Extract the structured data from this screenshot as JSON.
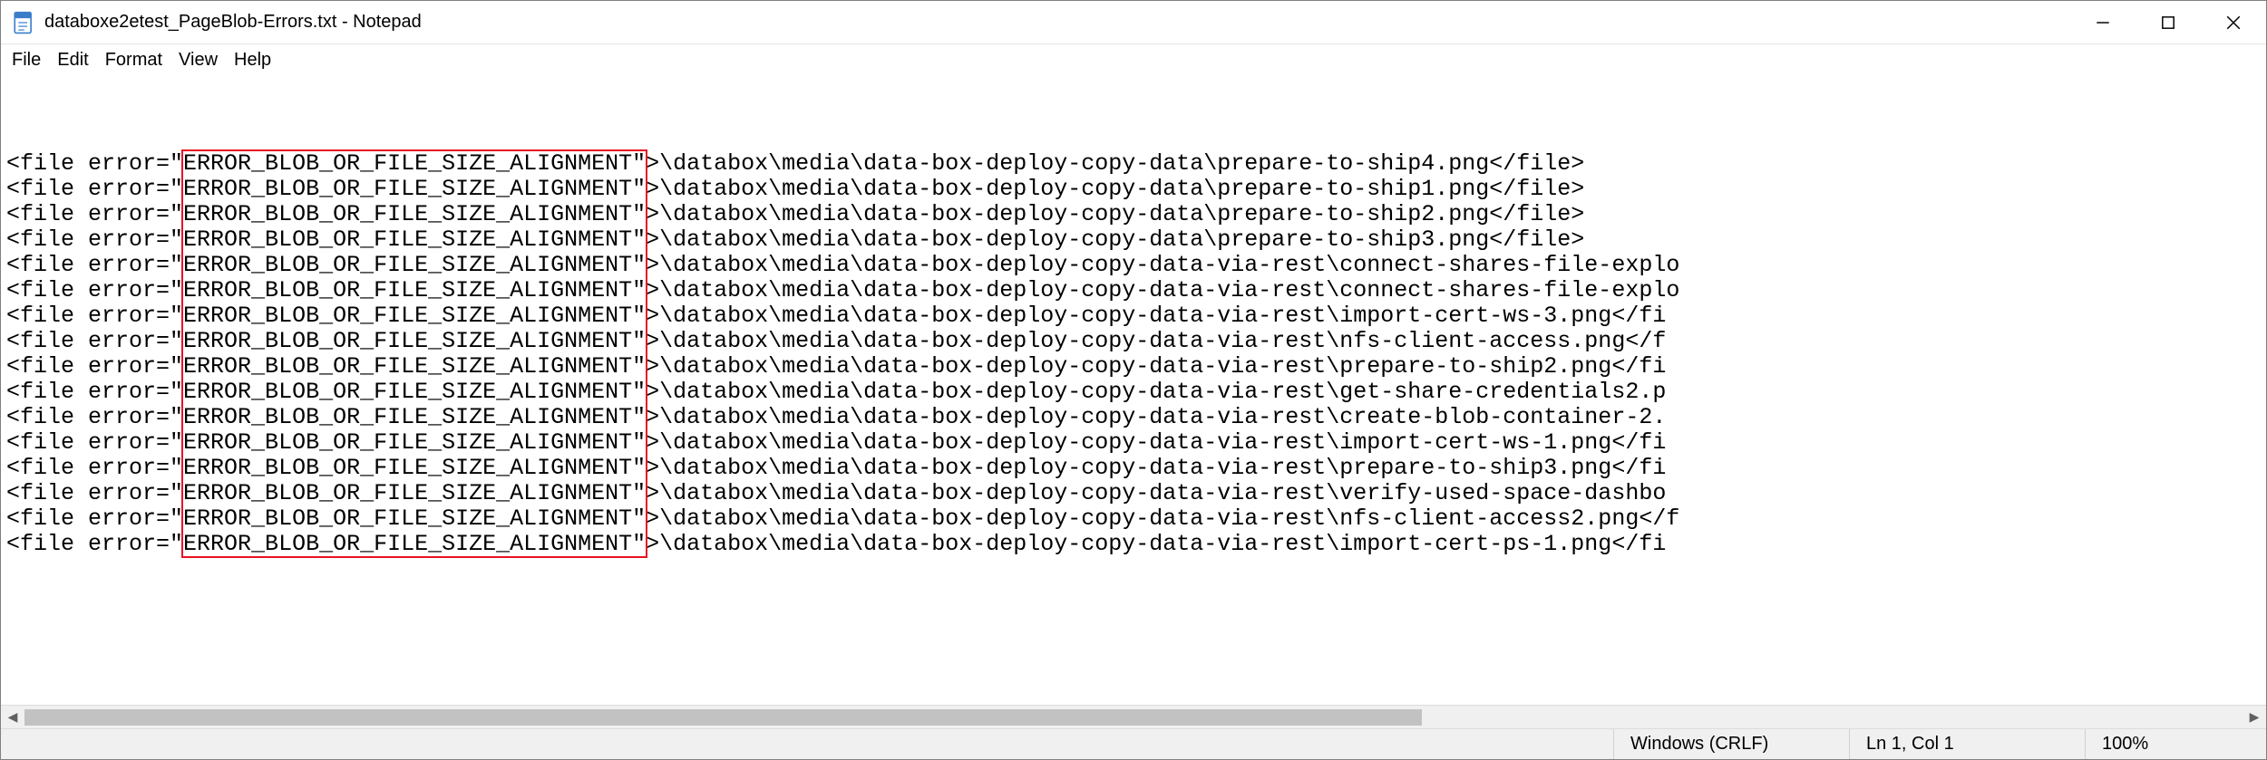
{
  "window": {
    "title": "databoxe2etest_PageBlob-Errors.txt - Notepad"
  },
  "menu": {
    "file": "File",
    "edit": "Edit",
    "format": "Format",
    "view": "View",
    "help": "Help"
  },
  "highlight_error": "ERROR_BLOB_OR_FILE_SIZE_ALIGNMENT",
  "lines": [
    {
      "prefix": "<file error=\"",
      "err": "ERROR_BLOB_OR_FILE_SIZE_ALIGNMENT\"",
      "rest": ">\\databox\\media\\data-box-deploy-copy-data\\prepare-to-ship4.png</file>"
    },
    {
      "prefix": "<file error=\"",
      "err": "ERROR_BLOB_OR_FILE_SIZE_ALIGNMENT\"",
      "rest": ">\\databox\\media\\data-box-deploy-copy-data\\prepare-to-ship1.png</file>"
    },
    {
      "prefix": "<file error=\"",
      "err": "ERROR_BLOB_OR_FILE_SIZE_ALIGNMENT\"",
      "rest": ">\\databox\\media\\data-box-deploy-copy-data\\prepare-to-ship2.png</file>"
    },
    {
      "prefix": "<file error=\"",
      "err": "ERROR_BLOB_OR_FILE_SIZE_ALIGNMENT\"",
      "rest": ">\\databox\\media\\data-box-deploy-copy-data\\prepare-to-ship3.png</file>"
    },
    {
      "prefix": "<file error=\"",
      "err": "ERROR_BLOB_OR_FILE_SIZE_ALIGNMENT\"",
      "rest": ">\\databox\\media\\data-box-deploy-copy-data-via-rest\\connect-shares-file-explo"
    },
    {
      "prefix": "<file error=\"",
      "err": "ERROR_BLOB_OR_FILE_SIZE_ALIGNMENT\"",
      "rest": ">\\databox\\media\\data-box-deploy-copy-data-via-rest\\connect-shares-file-explo"
    },
    {
      "prefix": "<file error=\"",
      "err": "ERROR_BLOB_OR_FILE_SIZE_ALIGNMENT\"",
      "rest": ">\\databox\\media\\data-box-deploy-copy-data-via-rest\\import-cert-ws-3.png</fi"
    },
    {
      "prefix": "<file error=\"",
      "err": "ERROR_BLOB_OR_FILE_SIZE_ALIGNMENT\"",
      "rest": ">\\databox\\media\\data-box-deploy-copy-data-via-rest\\nfs-client-access.png</f"
    },
    {
      "prefix": "<file error=\"",
      "err": "ERROR_BLOB_OR_FILE_SIZE_ALIGNMENT\"",
      "rest": ">\\databox\\media\\data-box-deploy-copy-data-via-rest\\prepare-to-ship2.png</fi"
    },
    {
      "prefix": "<file error=\"",
      "err": "ERROR_BLOB_OR_FILE_SIZE_ALIGNMENT\"",
      "rest": ">\\databox\\media\\data-box-deploy-copy-data-via-rest\\get-share-credentials2.p"
    },
    {
      "prefix": "<file error=\"",
      "err": "ERROR_BLOB_OR_FILE_SIZE_ALIGNMENT\"",
      "rest": ">\\databox\\media\\data-box-deploy-copy-data-via-rest\\create-blob-container-2."
    },
    {
      "prefix": "<file error=\"",
      "err": "ERROR_BLOB_OR_FILE_SIZE_ALIGNMENT\"",
      "rest": ">\\databox\\media\\data-box-deploy-copy-data-via-rest\\import-cert-ws-1.png</fi"
    },
    {
      "prefix": "<file error=\"",
      "err": "ERROR_BLOB_OR_FILE_SIZE_ALIGNMENT\"",
      "rest": ">\\databox\\media\\data-box-deploy-copy-data-via-rest\\prepare-to-ship3.png</fi"
    },
    {
      "prefix": "<file error=\"",
      "err": "ERROR_BLOB_OR_FILE_SIZE_ALIGNMENT\"",
      "rest": ">\\databox\\media\\data-box-deploy-copy-data-via-rest\\verify-used-space-dashbo"
    },
    {
      "prefix": "<file error=\"",
      "err": "ERROR_BLOB_OR_FILE_SIZE_ALIGNMENT\"",
      "rest": ">\\databox\\media\\data-box-deploy-copy-data-via-rest\\nfs-client-access2.png</f"
    },
    {
      "prefix": "<file error=\"",
      "err": "ERROR_BLOB_OR_FILE_SIZE_ALIGNMENT\"",
      "rest": ">\\databox\\media\\data-box-deploy-copy-data-via-rest\\import-cert-ps-1.png</fi"
    }
  ],
  "scrollbar": {
    "thumb_left_pct": 0,
    "thumb_width_pct": 63
  },
  "status": {
    "encoding_hint": "Windows (CRLF)",
    "position": "Ln 1, Col 1",
    "zoom": "100%"
  }
}
